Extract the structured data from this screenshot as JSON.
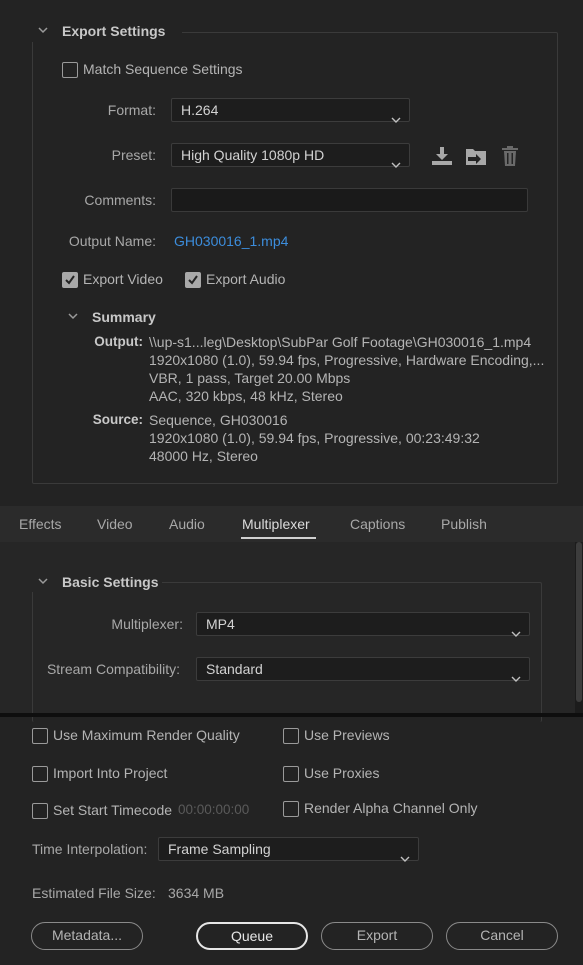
{
  "export_settings": {
    "title": "Export Settings",
    "match_sequence_label": "Match Sequence Settings",
    "match_sequence_checked": false,
    "format_label": "Format:",
    "format_value": "H.264",
    "preset_label": "Preset:",
    "preset_value": "High Quality 1080p HD",
    "preset_icons": [
      "save-preset-icon",
      "import-preset-icon",
      "delete-preset-icon"
    ],
    "comments_label": "Comments:",
    "comments_value": "",
    "output_name_label": "Output Name:",
    "output_name_value": "GH030016_1.mp4",
    "export_video_label": "Export Video",
    "export_video_checked": true,
    "export_audio_label": "Export Audio",
    "export_audio_checked": true
  },
  "summary": {
    "title": "Summary",
    "output_label": "Output:",
    "output_lines": [
      "\\\\up-s1...leg\\Desktop\\SubPar Golf Footage\\GH030016_1.mp4",
      "1920x1080 (1.0), 59.94 fps, Progressive, Hardware Encoding,...",
      "VBR, 1 pass, Target 20.00 Mbps",
      "AAC, 320 kbps, 48 kHz, Stereo"
    ],
    "source_label": "Source:",
    "source_lines": [
      "Sequence, GH030016",
      "1920x1080 (1.0), 59.94 fps, Progressive, 00:23:49:32",
      "48000 Hz, Stereo"
    ]
  },
  "tabs": {
    "items": [
      "Effects",
      "Video",
      "Audio",
      "Multiplexer",
      "Captions",
      "Publish"
    ],
    "active": "Multiplexer"
  },
  "basic_settings": {
    "title": "Basic Settings",
    "multiplexer_label": "Multiplexer:",
    "multiplexer_value": "MP4",
    "stream_label": "Stream Compatibility:",
    "stream_value": "Standard"
  },
  "render_options": {
    "max_render_quality": "Use Maximum Render Quality",
    "use_previews": "Use Previews",
    "import_into_project": "Import Into Project",
    "use_proxies": "Use Proxies",
    "set_start_timecode": "Set Start Timecode",
    "timecode_value": "00:00:00:00",
    "render_alpha": "Render Alpha Channel Only",
    "time_interp_label": "Time Interpolation:",
    "time_interp_value": "Frame Sampling",
    "est_size_label": "Estimated File Size:",
    "est_size_value": "3634 MB"
  },
  "buttons": {
    "metadata": "Metadata...",
    "queue": "Queue",
    "export": "Export",
    "cancel": "Cancel"
  }
}
